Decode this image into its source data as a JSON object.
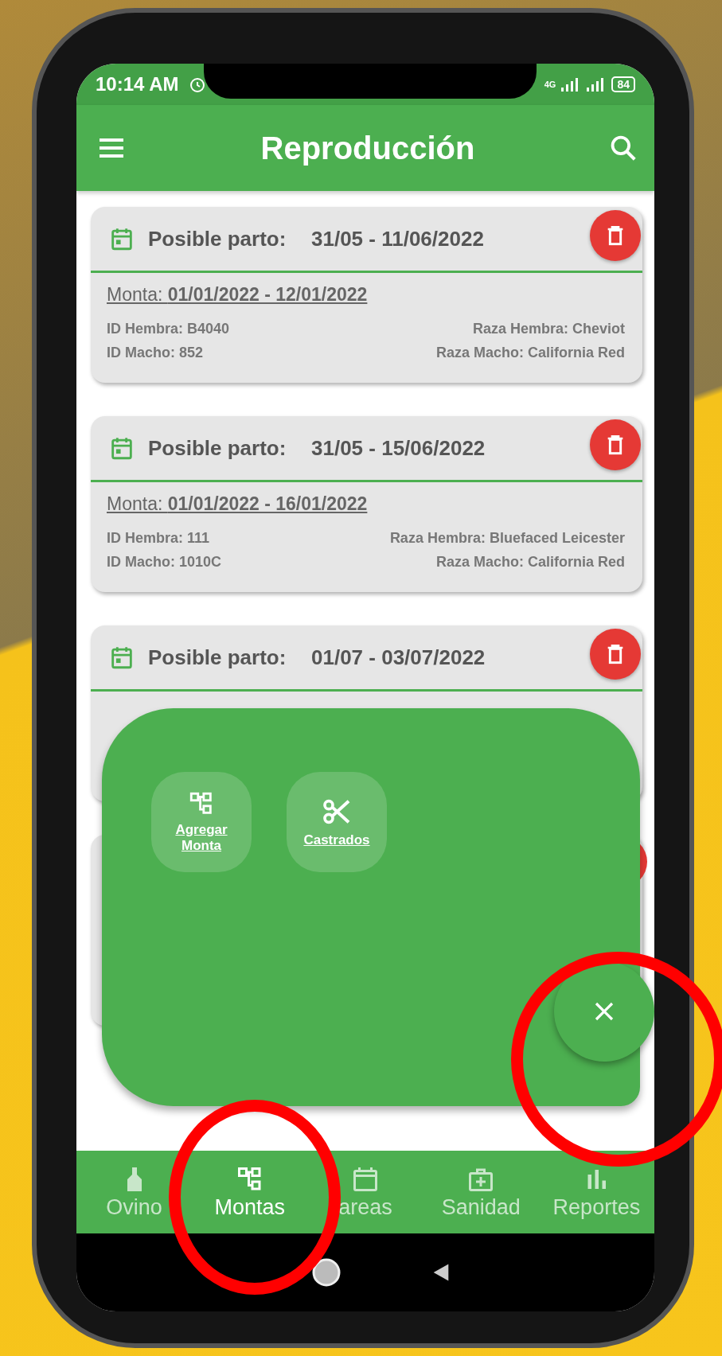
{
  "status_bar": {
    "time": "10:14 AM",
    "network": "4G",
    "battery": "84"
  },
  "app_bar": {
    "title": "Reproducción"
  },
  "cards": [
    {
      "label": "Posible parto:",
      "range": "31/05 - 11/06/2022",
      "monta": "Monta: **01/01/2022 - 12/01/2022**",
      "id_hembra": "ID Hembra: B4040",
      "raza_hembra": "Raza Hembra: Cheviot",
      "id_macho": "ID Macho: 852",
      "raza_macho": "Raza Macho: California Red"
    },
    {
      "label": "Posible parto:",
      "range": "31/05 - 15/06/2022",
      "monta": "Monta: **01/01/2022 - 16/01/2022**",
      "id_hembra": "ID Hembra: 111",
      "raza_hembra": "Raza Hembra: Bluefaced Leicester",
      "id_macho": "ID Macho: 1010C",
      "raza_macho": "Raza Macho: California Red"
    },
    {
      "label": "Posible parto:",
      "range": "01/07 - 03/07/2022"
    }
  ],
  "menu": {
    "actions": [
      {
        "label": "Agregar Monta",
        "kind": "tree"
      },
      {
        "label": "Castrados",
        "kind": "scissors"
      }
    ]
  },
  "bottom_nav": [
    {
      "label": "Ovino",
      "kind": "bottle",
      "selected": false
    },
    {
      "label": "Montas",
      "kind": "tree",
      "selected": true
    },
    {
      "label": "areas",
      "kind": "calendar",
      "selected": false
    },
    {
      "label": "Sanidad",
      "kind": "medkit",
      "selected": false
    },
    {
      "label": "Reportes",
      "kind": "chart",
      "selected": false
    }
  ]
}
